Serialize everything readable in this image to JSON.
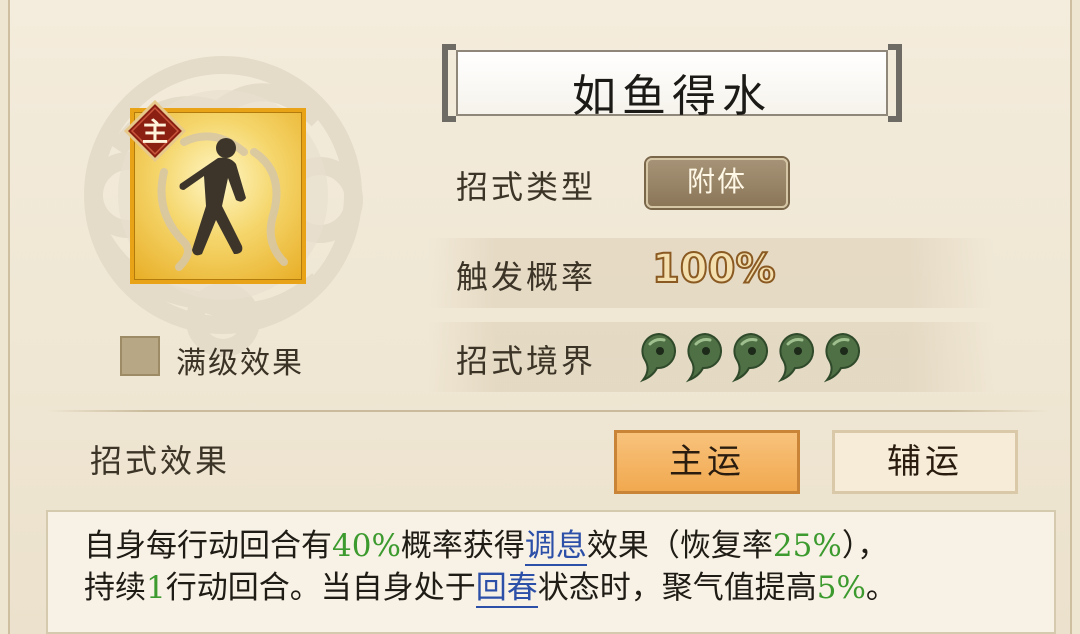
{
  "skill": {
    "name": "如鱼得水",
    "badge": "主",
    "max_level_label": "满级效果"
  },
  "info": {
    "type_label": "招式类型",
    "type_value": "附体",
    "rate_label": "触发概率",
    "rate_value": "100%",
    "realm_label": "招式境界",
    "realm_level": 5
  },
  "effect": {
    "label": "招式效果",
    "tabs": [
      {
        "label": "主运",
        "active": true
      },
      {
        "label": "辅运",
        "active": false
      }
    ],
    "line1": {
      "t1": "自身每行动回合有",
      "v1": "40%",
      "t2": "概率获得",
      "link1": "调息",
      "t3": "效果（恢复率",
      "v2": "25%",
      "t4": "），"
    },
    "line2": {
      "t1": "持续",
      "v1": "1",
      "t2": "行动回合。当自身处于",
      "link1": "回春",
      "t3": "状态时，聚气值提高",
      "v2": "5%",
      "t4": "。"
    }
  },
  "colors": {
    "accent_orange": "#f1a94f",
    "highlight_green": "#3c9a2e",
    "link_blue": "#2c4fa8",
    "icon_gold": "#e9a316"
  }
}
